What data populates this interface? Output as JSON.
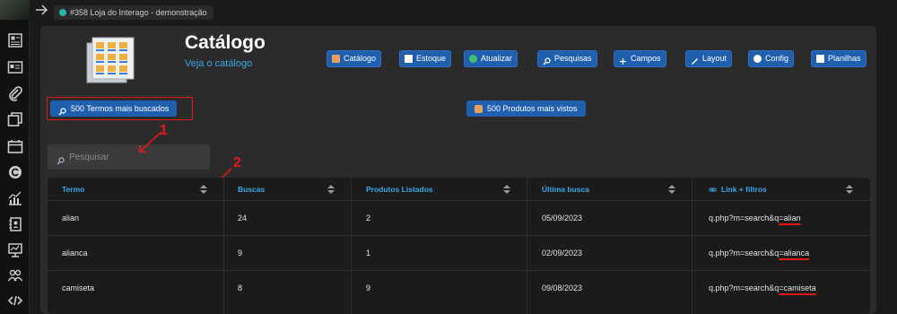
{
  "project": {
    "tab_label": "#358 Loja do Interago - demonstração"
  },
  "header": {
    "title": "Catálogo",
    "subtitle": "Veja o catálogo",
    "nav": [
      {
        "label": "Catálogo",
        "icon": "catalog-icon"
      },
      {
        "label": "Estoque",
        "icon": "stock-icon"
      },
      {
        "label": "Atualizar",
        "icon": "refresh-icon"
      },
      {
        "label": "Pesquisas",
        "icon": "magnifier-icon"
      },
      {
        "label": "Campos",
        "icon": "plus-icon"
      },
      {
        "label": "Layout",
        "icon": "brush-icon"
      },
      {
        "label": "Config",
        "icon": "gear-icon"
      },
      {
        "label": "Planilhas",
        "icon": "spreadsheet-icon"
      }
    ]
  },
  "tabs": {
    "terms": "500 Termos mais buscados",
    "products": "500 Produtos mais vistos"
  },
  "search": {
    "placeholder": "Pesquisar"
  },
  "annotations": {
    "one": "1",
    "two": "2"
  },
  "table": {
    "headers": [
      "Termo",
      "Buscas",
      "Produtos Listados",
      "Última busca",
      "Link + filtros"
    ],
    "rows": [
      {
        "termo": "alian",
        "buscas": "24",
        "produtos": "2",
        "ultima": "05/09/2023",
        "link_prefix": "q.php?m=search&q",
        "link_query": "=alian"
      },
      {
        "termo": "alianca",
        "buscas": "9",
        "produtos": "1",
        "ultima": "02/09/2023",
        "link_prefix": "q.php?m=search&q",
        "link_query": "=alianca"
      },
      {
        "termo": "camiseta",
        "buscas": "8",
        "produtos": "9",
        "ultima": "09/08/2023",
        "link_prefix": "q.php?m=search&q",
        "link_query": "=camiseta"
      }
    ]
  },
  "colors": {
    "accent": "#1f5fae",
    "link": "#3ba7e6",
    "annotation": "#e01919"
  }
}
